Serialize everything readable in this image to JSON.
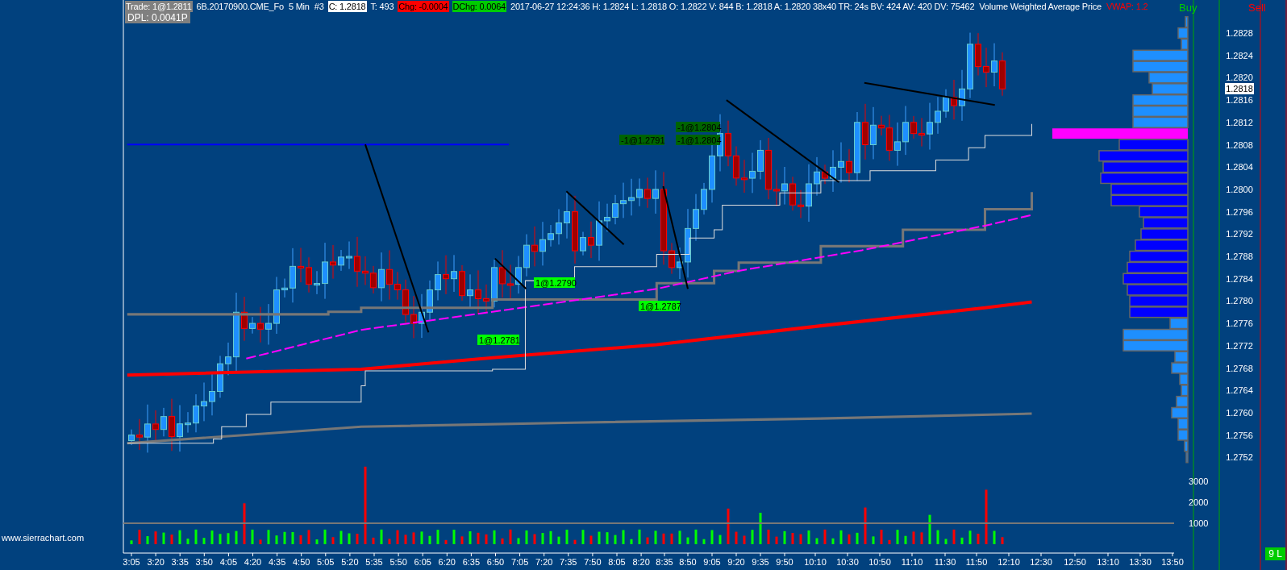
{
  "header": {
    "segments": [
      {
        "kind": "label",
        "text": "Trade: 1@1.2811"
      },
      {
        "kind": "plain",
        "text": "6B.20170900.CME_Fo"
      },
      {
        "kind": "plain",
        "text": "5 Min"
      },
      {
        "kind": "plain",
        "text": "#3"
      },
      {
        "kind": "value",
        "text": "C: 1.2818"
      },
      {
        "kind": "plain",
        "text": "T: 493"
      },
      {
        "kind": "down",
        "text": "Chg: -0.0004"
      },
      {
        "kind": "up",
        "text": "DChg: 0.0064"
      },
      {
        "kind": "plain",
        "text": "2017-06-27 12:24:36 H: 1.2824 L: 1.2818 O: 1.2822 V: 844 B: 1.2818 A: 1.2820 38x40 TR: 24s BV: 424 AV: 420 DV: 75462"
      },
      {
        "kind": "plain",
        "text": "Volume Weighted Average Price"
      },
      {
        "kind": "alert",
        "text": "VWAP: 1.2"
      }
    ],
    "second_line": "DPL: 0.0041P"
  },
  "order_columns": [
    {
      "label": "Buy",
      "kind": "buy"
    },
    {
      "label": "Sell",
      "kind": "sell"
    }
  ],
  "price_axis": {
    "labels": [
      "1.2828",
      "1.2824",
      "1.2820",
      "1.2816",
      "1.2812",
      "1.2808",
      "1.2804",
      "1.2800",
      "1.2796",
      "1.2792",
      "1.2788",
      "1.2784",
      "1.2780",
      "1.2776",
      "1.2772",
      "1.2768",
      "1.2764",
      "1.2760",
      "1.2756",
      "1.2752"
    ],
    "current_price": "1.2818"
  },
  "trade_markers": [
    {
      "text": "-1@1.2791",
      "kind": "sell"
    },
    {
      "text": "-1@1.2804",
      "kind": "sell"
    },
    {
      "text": "-1@1.2804",
      "kind": "sell"
    },
    {
      "text": "1@1.2790",
      "kind": "buy"
    },
    {
      "text": "1@1.2787",
      "kind": "buy"
    },
    {
      "text": "1@1.2781",
      "kind": "buy"
    }
  ],
  "volume_axis": [
    "3000",
    "2000",
    "1000"
  ],
  "time_axis": [
    "3:05",
    "3:20",
    "3:35",
    "3:50",
    "4:05",
    "4:20",
    "4:35",
    "4:50",
    "5:05",
    "5:20",
    "5:35",
    "5:50",
    "6:05",
    "6:20",
    "6:35",
    "6:50",
    "7:05",
    "7:20",
    "7:35",
    "7:50",
    "8:05",
    "8:20",
    "8:35",
    "8:50",
    "9:05",
    "9:20",
    "9:35",
    "9:50",
    "10:10",
    "10:30",
    "10:50",
    "11:10",
    "11:30",
    "11:50",
    "12:10",
    "12:30",
    "12:50",
    "13:10",
    "13:30",
    "13:50"
  ],
  "footer_link": "www.sierrachart.com",
  "status_badge": "9 L"
}
